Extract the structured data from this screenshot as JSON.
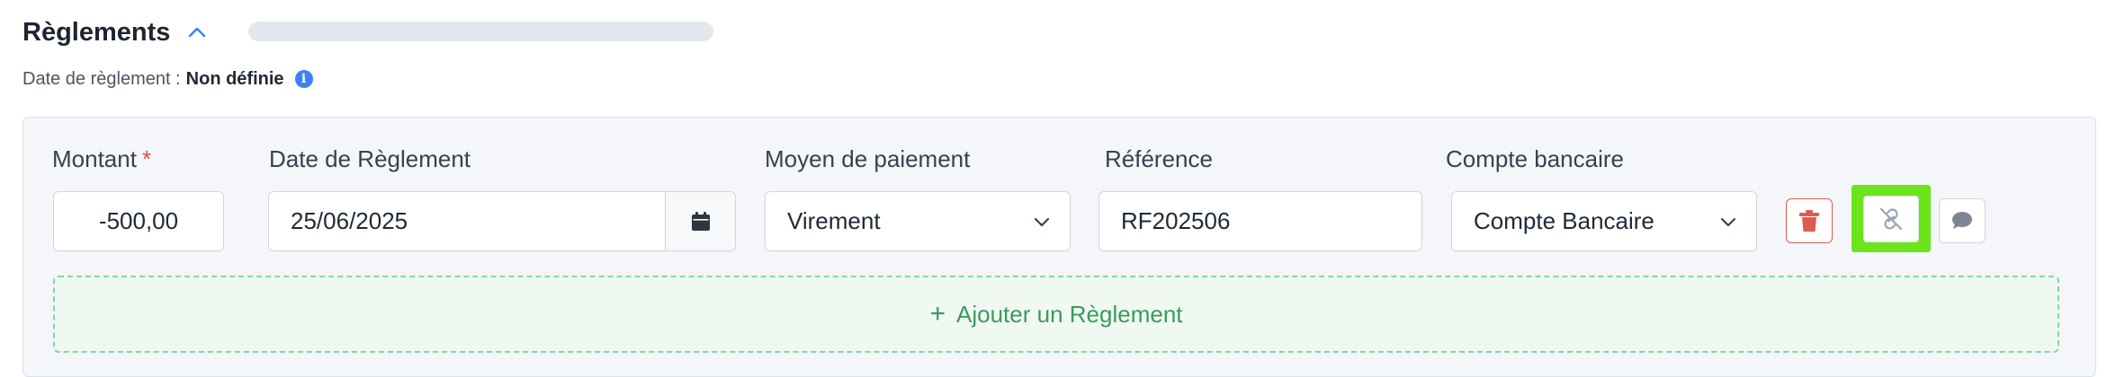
{
  "section": {
    "title": "Règlements",
    "date_label": "Date de règlement :",
    "date_value": "Non définie"
  },
  "labels": {
    "amount": "Montant",
    "required_mark": "*",
    "date": "Date de Règlement",
    "payment_method": "Moyen de paiement",
    "reference": "Référence",
    "bank_account": "Compte bancaire"
  },
  "row": {
    "amount": "-500,00",
    "date": "25/06/2025",
    "payment_method": "Virement",
    "reference": "RF202506",
    "bank_account": "Compte Bancaire"
  },
  "actions": {
    "delete_icon": "trash-icon",
    "unlink_icon": "unlink-icon",
    "comment_icon": "comment-icon"
  },
  "add_button": {
    "plus": "+",
    "label": "Ajouter un Règlement"
  },
  "colors": {
    "danger": "#e05a4d",
    "highlight": "#6be51a",
    "success": "#3a9b5c",
    "info": "#3b82f6"
  }
}
